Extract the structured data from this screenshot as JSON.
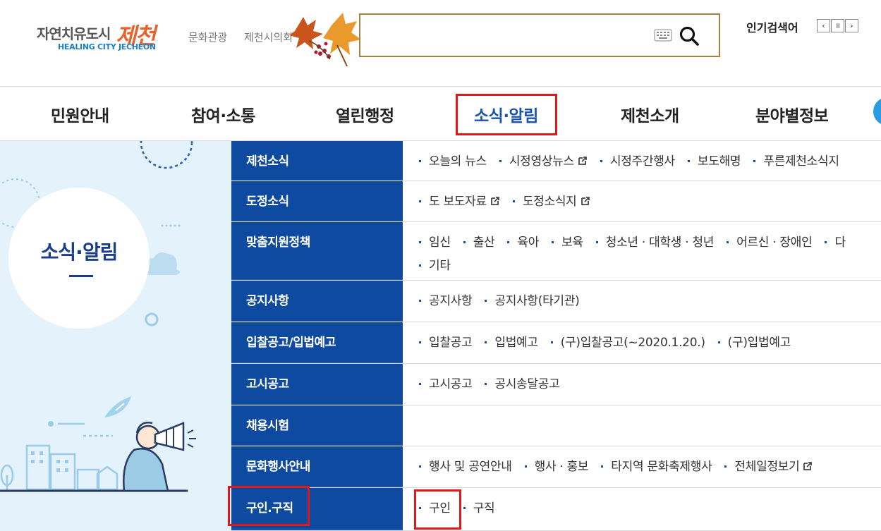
{
  "header": {
    "logo_ko": "자연치유도시",
    "logo_script": "제천",
    "logo_en": "HEALING CITY JECHEON",
    "util_links": [
      "문화관광",
      "제천시의회"
    ],
    "search_value": "",
    "popular_label": "인기검색어",
    "popular_controls": [
      "‹",
      "॥",
      "›"
    ]
  },
  "gnb": {
    "items": [
      "민원안내",
      "참여·소통",
      "열린행정",
      "소식·알림",
      "제천소개",
      "분야별정보"
    ],
    "active_index": 3
  },
  "visual": {
    "title": "소식·알림"
  },
  "sitemap": {
    "rows": [
      {
        "head": "제천소식",
        "links": [
          {
            "label": "오늘의 뉴스"
          },
          {
            "label": "시정영상뉴스",
            "ext": true
          },
          {
            "label": "시정주간행사"
          },
          {
            "label": "보도해명"
          },
          {
            "label": "푸른제천소식지"
          }
        ]
      },
      {
        "head": "도정소식",
        "links": [
          {
            "label": "도 보도자료",
            "ext": true
          },
          {
            "label": "도정소식지",
            "ext": true
          }
        ]
      },
      {
        "head": "맞춤지원정책",
        "links": [
          {
            "label": "임신"
          },
          {
            "label": "출산"
          },
          {
            "label": "육아"
          },
          {
            "label": "보육"
          },
          {
            "label": "청소년 · 대학생 · 청년"
          },
          {
            "label": "어르신 · 장애인"
          },
          {
            "label": "다"
          }
        ],
        "links2": [
          {
            "label": "기타"
          }
        ]
      },
      {
        "head": "공지사항",
        "links": [
          {
            "label": "공지사항"
          },
          {
            "label": "공지사항(타기관)"
          }
        ]
      },
      {
        "head": "입찰공고/입법예고",
        "links": [
          {
            "label": "입찰공고"
          },
          {
            "label": "입법예고"
          },
          {
            "label": "(구)입찰공고(~2020.1.20.)"
          },
          {
            "label": "(구)입법예고"
          }
        ]
      },
      {
        "head": "고시공고",
        "links": [
          {
            "label": "고시공고"
          },
          {
            "label": "공시송달공고"
          }
        ]
      },
      {
        "head": "채용시험",
        "links": []
      },
      {
        "head": "문화행사안내",
        "links": [
          {
            "label": "행사 및 공연안내"
          },
          {
            "label": "행사 · 홍보"
          },
          {
            "label": "타지역 문화축제행사"
          },
          {
            "label": "전체일정보기",
            "ext": true
          }
        ]
      },
      {
        "head": "구인.구직",
        "links": [
          {
            "label": "구인"
          },
          {
            "label": "구직"
          }
        ]
      }
    ]
  },
  "colors": {
    "accent": "#1a54a8",
    "nav_bg": "#0e4aa0",
    "highlight": "#e01818",
    "search_border": "#a8813e"
  }
}
